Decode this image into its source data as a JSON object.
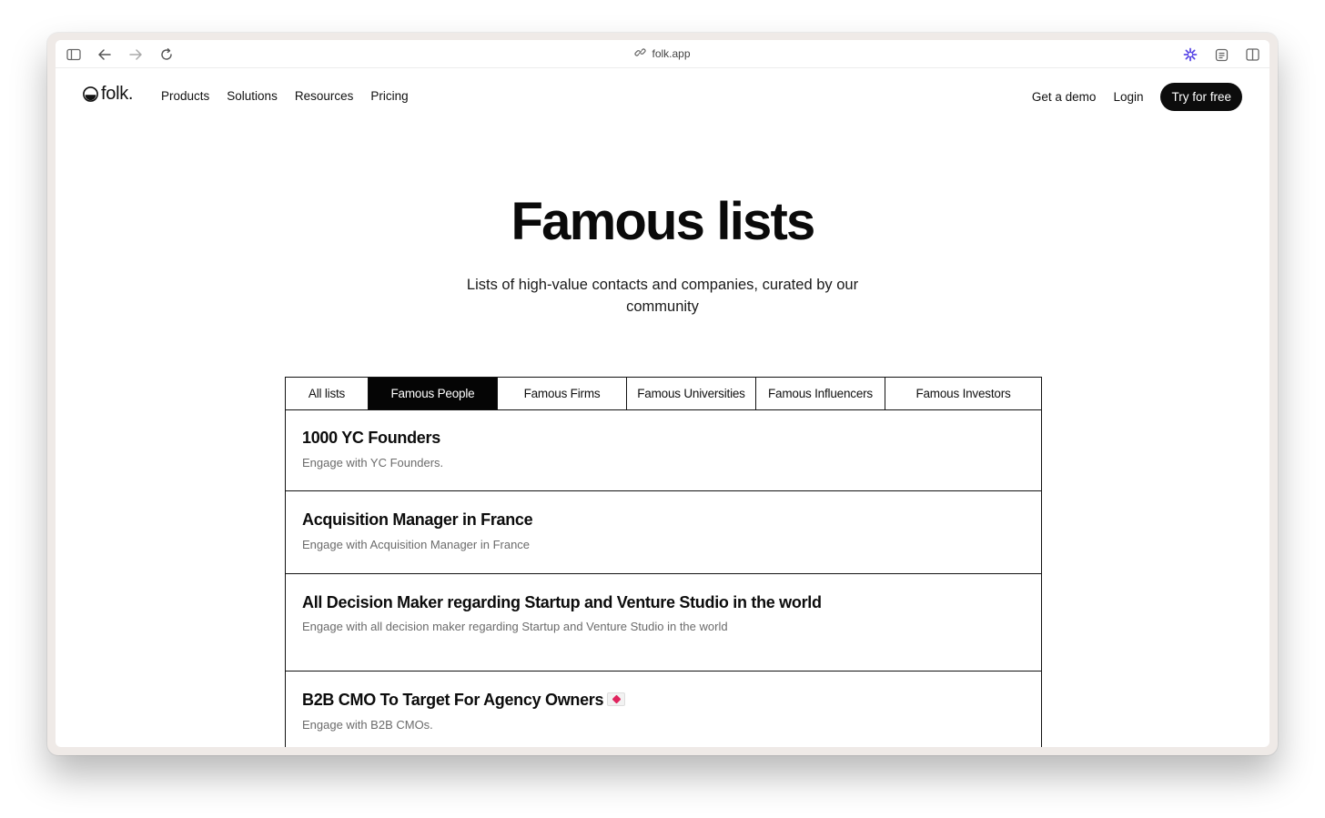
{
  "browser": {
    "url": "folk.app",
    "icons": [
      "sidebar-icon",
      "back-arrow-icon",
      "forward-arrow-icon",
      "reload-icon",
      "link-icon",
      "extension-icon",
      "reader-icon",
      "split-view-icon"
    ]
  },
  "nav": {
    "logo": "folk.",
    "menu": [
      "Products",
      "Solutions",
      "Resources",
      "Pricing"
    ],
    "get_demo": "Get a demo",
    "login": "Login",
    "cta": "Try for free"
  },
  "hero": {
    "title": "Famous lists",
    "subtitle": "Lists of high-value contacts and companies, curated by our community"
  },
  "tabs": [
    {
      "label": "All lists",
      "active": false
    },
    {
      "label": "Famous People",
      "active": true
    },
    {
      "label": "Famous Firms",
      "active": false
    },
    {
      "label": "Famous Universities",
      "active": false
    },
    {
      "label": "Famous Influencers",
      "active": false
    },
    {
      "label": "Famous Investors",
      "active": false
    }
  ],
  "lists": [
    {
      "title": "1000 YC Founders",
      "desc": "Engage with YC Founders."
    },
    {
      "title": "Acquisition Manager in France",
      "desc": "Engage with Acquisition Manager in France"
    },
    {
      "title": "All Decision Maker regarding Startup and Venture Studio in the world",
      "desc": "Engage with all decision maker regarding Startup and Venture Studio in the world"
    },
    {
      "title": "B2B CMO To Target For Agency Owners",
      "desc": "Engage with B2B CMOs.",
      "emoji": "love-letter-icon"
    }
  ],
  "colors": {
    "accent": "#050505",
    "muted": "#6b6b6b",
    "extension": "#5b4ae6"
  }
}
